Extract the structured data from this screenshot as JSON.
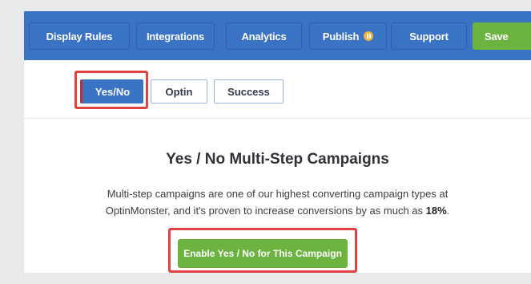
{
  "nav": {
    "display_rules": "Display Rules",
    "integrations": "Integrations",
    "analytics": "Analytics",
    "publish": "Publish",
    "support": "Support",
    "save": "Save"
  },
  "tabs": {
    "yes_no": "Yes/No",
    "optin": "Optin",
    "success": "Success",
    "active": "Yes/No"
  },
  "content": {
    "title": "Yes / No Multi-Step Campaigns",
    "desc_line1": "Multi-step campaigns are one of our highest converting campaign types at",
    "desc_line2_prefix": "OptinMonster, and it's proven to increase conversions by as much as ",
    "desc_line2_bold": "18%",
    "desc_line2_suffix": ".",
    "cta": "Enable Yes / No for This Campaign"
  },
  "colors": {
    "topbar": "#3b73c4",
    "green": "#6cb33f",
    "highlight": "#e2423f",
    "badge": "#f3b23c"
  }
}
